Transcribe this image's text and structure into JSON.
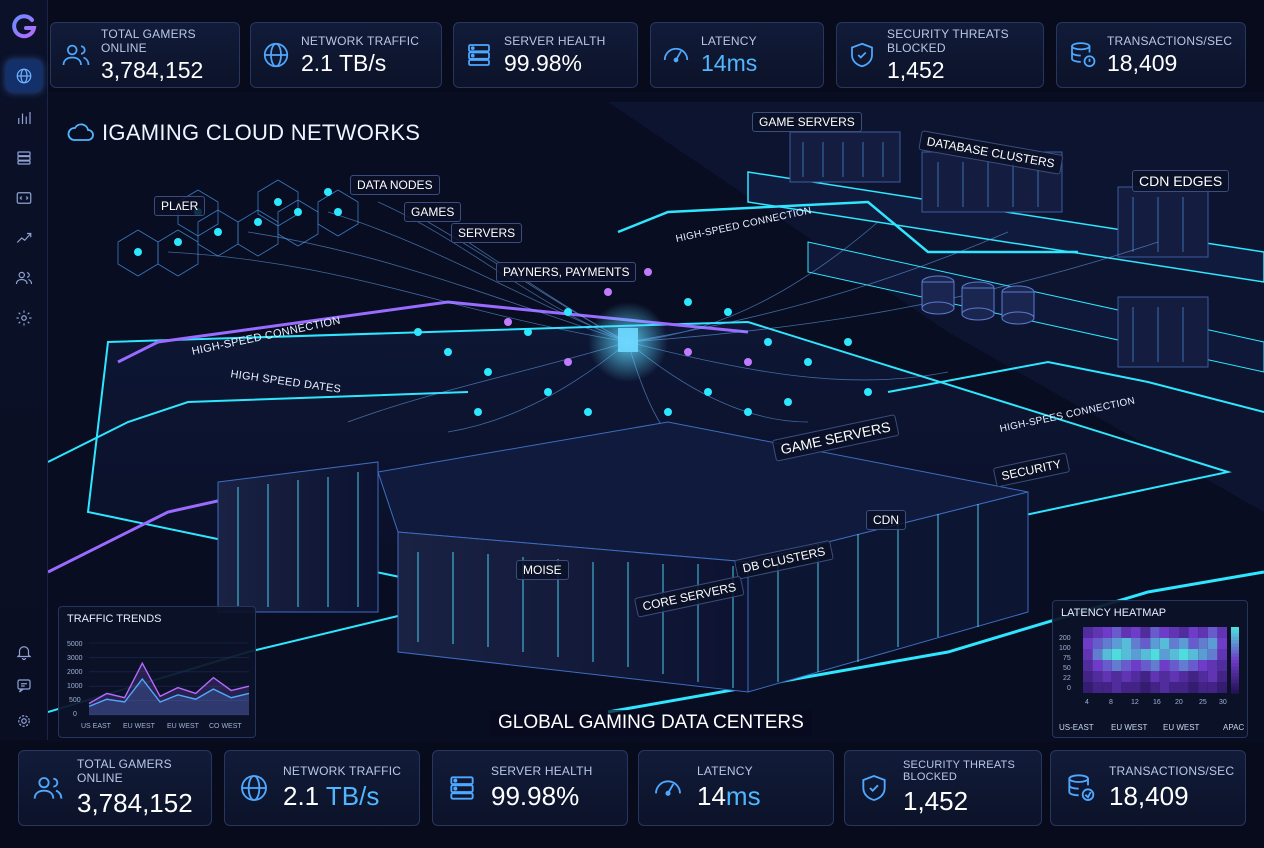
{
  "scene_title": "IGAMING CLOUD NETWORKS",
  "top_stats": [
    {
      "label": "TOTAL GAMERS ONLINE",
      "value": "3,784,152",
      "unit": "",
      "icon": "users-icon"
    },
    {
      "label": "NETWORK TRAFFIC",
      "value": "2.1 TB/s",
      "unit": "",
      "icon": "globe-icon"
    },
    {
      "label": "SERVER HEALTH",
      "value": "99.98%",
      "unit": "",
      "icon": "server-icon"
    },
    {
      "label": "LATENCY",
      "value": "14ms",
      "unit": "",
      "icon": "gauge-icon"
    },
    {
      "label": "SECURITY THREATS BLOCKED",
      "value": "1,452",
      "unit": "",
      "icon": "shield-icon"
    },
    {
      "label": "TRANSACTIONS/SEC",
      "value": "18,409",
      "unit": "",
      "icon": "database-icon"
    }
  ],
  "bottom_stats": [
    {
      "label": "TOTAL GAMERS ONLINE",
      "value": "3,784,152",
      "unit": "",
      "icon": "users-icon"
    },
    {
      "label": "NETWORK TRAFFIC",
      "value": "2.1 ",
      "unit": "TB/s",
      "icon": "globe-icon"
    },
    {
      "label": "SERVER HEALTH",
      "value": "99.98%",
      "unit": "",
      "icon": "server-icon"
    },
    {
      "label": "LATENCY",
      "value": "14",
      "unit": "ms",
      "icon": "gauge-icon"
    },
    {
      "label": "SECURITY THREATS BLOCKED",
      "value": "1,452",
      "unit": "",
      "icon": "shield-icon"
    },
    {
      "label": "TRANSACTIONS/SEC",
      "value": "18,409",
      "unit": "",
      "icon": "database-icon"
    }
  ],
  "network_labels": {
    "player": "PLʌER",
    "data_nodes": "DATA NODES",
    "games": "GAMES",
    "servers": "SERVERS",
    "payments": "PAYNERS, PAYMENTS",
    "game_servers_top": "GAME SERVERS",
    "database_clusters": "DATABASE CLUSTERS",
    "cdn_edges": "CDN EDGES",
    "high_speed_1": "HIGH-SPEED CONNECTION",
    "high_speed_2": "HIGH-SPEED CONNECTION",
    "high_speed_dates": "HIGH SPEED DATES",
    "high_speed_3": "HIGH-SPEES CONNECTION",
    "game_servers_mid": "GAME SERVERS",
    "security": "SECURITY",
    "cdn": "CDN",
    "db_clusters": "DB CLUSTERS",
    "core_servers": "CORE SERVERS",
    "misc": "MOISE",
    "datacenter_title": "GLOBAL GAMING DATA CENTERS"
  },
  "traffic_trends": {
    "title": "TRAFFIC TRENDS",
    "y_ticks": [
      "5000",
      "3000",
      "2000",
      "1000",
      "500",
      "0"
    ],
    "x_ticks": [
      "US EAST",
      "EU WEST",
      "EU WEST",
      "CO WEST"
    ]
  },
  "latency_heatmap": {
    "title": "LATENCY HEATMAP",
    "y_ticks": [
      "200",
      "100",
      "75",
      "50",
      "22",
      "0"
    ],
    "x_ticks": [
      "4",
      "8",
      "12",
      "16",
      "20",
      "25",
      "30"
    ],
    "regions": [
      "US-EAST",
      "EU WEST",
      "EU WEST",
      "APAC"
    ]
  },
  "colors": {
    "accent": "#4fa8ff",
    "cyan": "#2fe6ff",
    "purple": "#b46bff",
    "bg": "#070b1c"
  },
  "chart_data": [
    {
      "type": "line",
      "title": "TRAFFIC TRENDS",
      "x": [
        "US EAST",
        "EU WEST",
        "EU WEST",
        "CO WEST"
      ],
      "series": [
        {
          "values": [
            800,
            1500,
            1200,
            3600,
            1300,
            1900,
            1500,
            2600,
            1700,
            2000
          ]
        },
        {
          "values": [
            600,
            1100,
            900,
            2500,
            900,
            1400,
            1100,
            1800,
            1200,
            1500
          ]
        }
      ],
      "ylim": [
        0,
        5000
      ]
    },
    {
      "type": "heatmap",
      "title": "LATENCY HEATMAP",
      "x": [
        "4",
        "8",
        "12",
        "16",
        "20",
        "25",
        "30"
      ],
      "y": [
        "200",
        "100",
        "75",
        "50",
        "22",
        "0"
      ],
      "values": [
        [
          0.3,
          0.4,
          0.5,
          0.6,
          0.4,
          0.5,
          0.3,
          0.6,
          0.5,
          0.4,
          0.3,
          0.5,
          0.4,
          0.6,
          0.4
        ],
        [
          0.5,
          0.6,
          0.7,
          0.8,
          0.9,
          0.7,
          0.6,
          0.8,
          0.9,
          0.7,
          0.8,
          0.6,
          0.7,
          0.8,
          0.5
        ],
        [
          0.4,
          0.7,
          0.9,
          1.0,
          0.9,
          0.8,
          0.9,
          1.0,
          0.8,
          0.9,
          1.0,
          0.9,
          0.8,
          0.7,
          0.4
        ],
        [
          0.3,
          0.5,
          0.6,
          0.7,
          0.6,
          0.5,
          0.6,
          0.7,
          0.5,
          0.6,
          0.7,
          0.6,
          0.5,
          0.4,
          0.3
        ],
        [
          0.2,
          0.3,
          0.4,
          0.3,
          0.4,
          0.3,
          0.2,
          0.4,
          0.3,
          0.4,
          0.3,
          0.2,
          0.3,
          0.4,
          0.2
        ],
        [
          0.1,
          0.2,
          0.2,
          0.3,
          0.2,
          0.2,
          0.1,
          0.2,
          0.3,
          0.2,
          0.2,
          0.1,
          0.2,
          0.2,
          0.1
        ]
      ]
    }
  ]
}
